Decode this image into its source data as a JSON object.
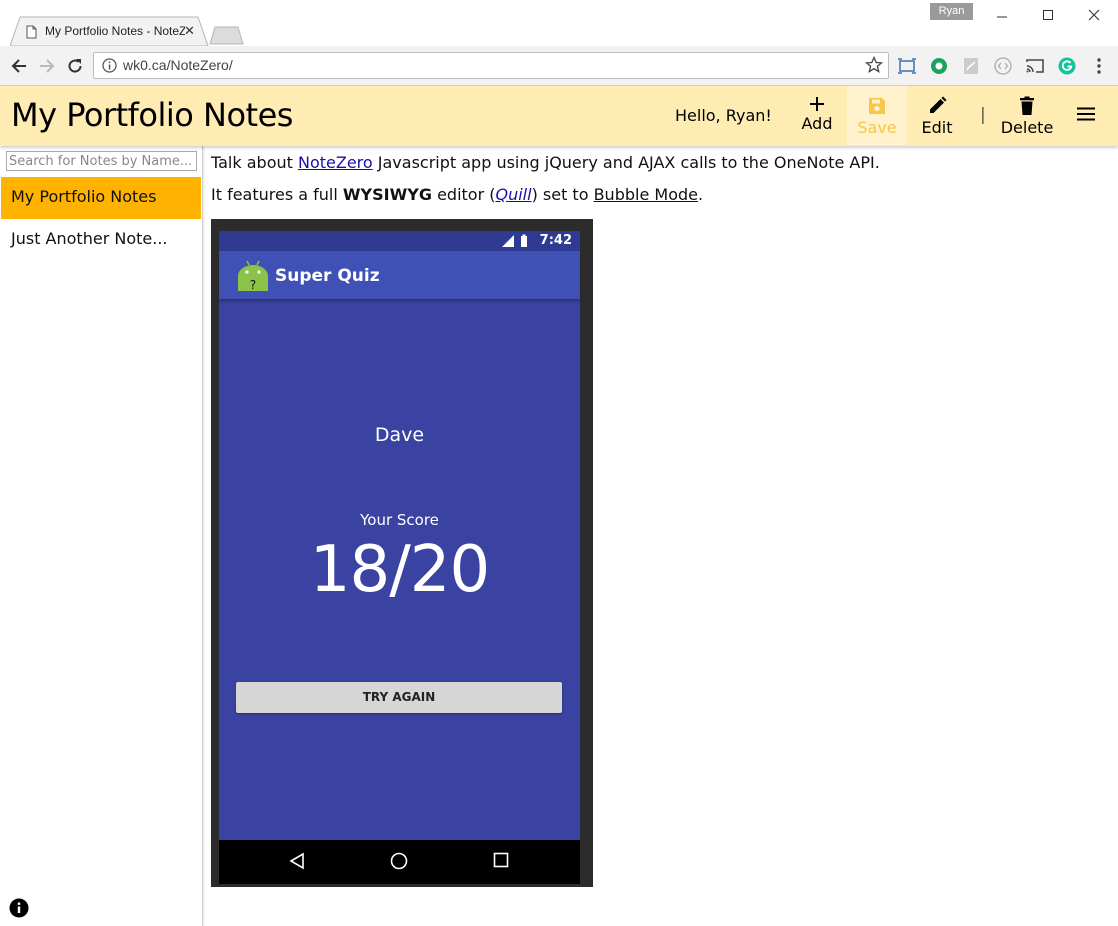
{
  "browser": {
    "tab_title": "My Portfolio Notes - NoteZero",
    "tab_close": "✕",
    "profile_name": "Ryan",
    "url": "wk0.ca/NoteZero/"
  },
  "header": {
    "title": "My Portfolio Notes",
    "greeting": "Hello, Ryan!",
    "buttons": {
      "add": "Add",
      "save": "Save",
      "edit": "Edit",
      "delete": "Delete"
    },
    "separator": "|"
  },
  "sidebar": {
    "search_placeholder": "Search for Notes by Name...",
    "notes": [
      {
        "label": "My Portfolio Notes",
        "active": true
      },
      {
        "label": "Just Another Note..."
      }
    ]
  },
  "content": {
    "line1": {
      "pre": "Talk about ",
      "link": "NoteZero",
      "post": " Javascript app using jQuery and AJAX calls to the OneNote API."
    },
    "line2": {
      "pre": "It features a full ",
      "bold": "WYSIWYG",
      "mid": " editor (",
      "link": "Quill",
      "mid2": ") set to ",
      "underline": "Bubble Mode",
      "post": "."
    }
  },
  "phone": {
    "time": "7:42",
    "app_title": "Super Quiz",
    "player_name": "Dave",
    "score_label": "Your Score",
    "score": "18/20",
    "button": "TRY AGAIN"
  },
  "colors": {
    "header_bg": "#ffecb3",
    "active_note": "#ffb300",
    "save_disabled": "#f7c64b",
    "phone_bg": "#3a43a1",
    "appbar": "#3f51b5"
  }
}
